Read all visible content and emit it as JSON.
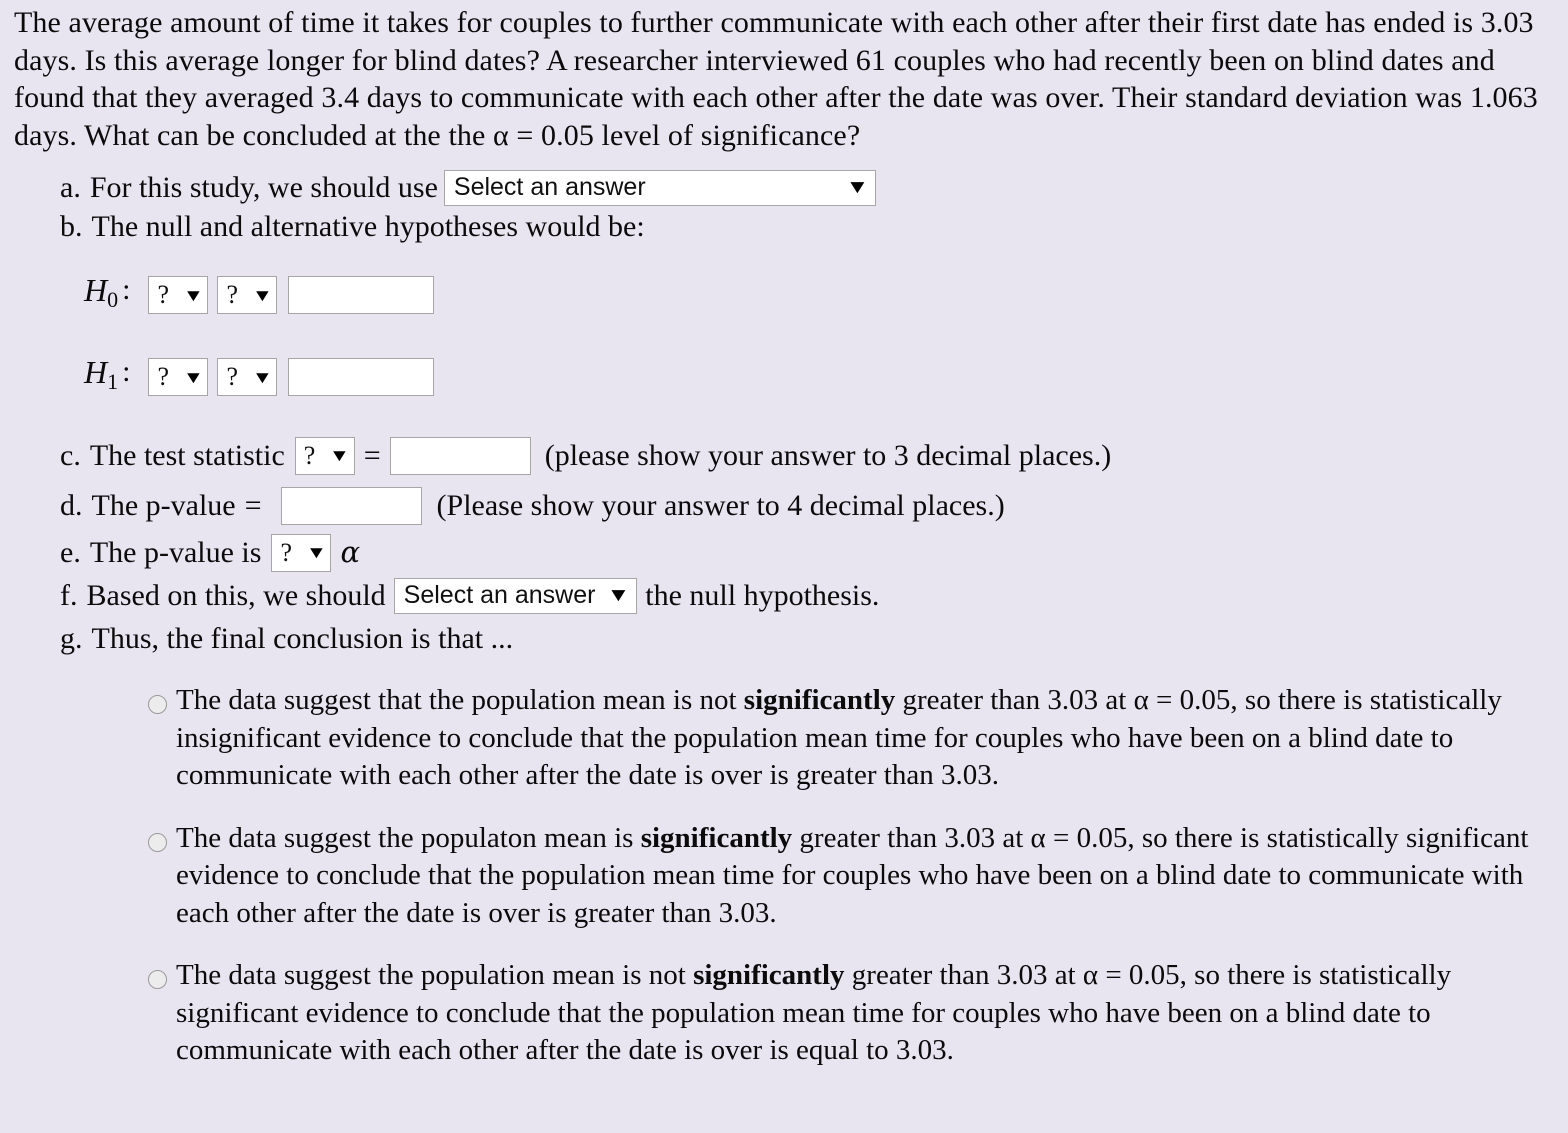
{
  "prompt": "The average amount of time it takes for couples to further communicate with each other after their first date has ended is 3.03 days.  Is this average longer for blind dates? A researcher interviewed 61 couples who had recently been on blind dates and found that they averaged 3.4 days to communicate with each other after the date was over.  Their standard deviation was 1.063 days. What can be concluded at the the α = 0.05 level of significance?",
  "questions": {
    "a": {
      "label": "a.",
      "text": "For this study, we should use",
      "select_value": "Select an answer",
      "caret": "▼"
    },
    "b": {
      "label": "b.",
      "text": "The null and alternative hypotheses would be:"
    },
    "h0": {
      "symbol": "H",
      "subscript": "0",
      "colon": ":",
      "dropdown1": "?",
      "dropdown2": "?",
      "value": "",
      "caret": "▼"
    },
    "h1": {
      "symbol": "H",
      "subscript": "1",
      "colon": ":",
      "dropdown1": "?",
      "dropdown2": "?",
      "value": "",
      "caret": "▼"
    },
    "c": {
      "label": "c.",
      "text": "The test statistic",
      "dropdown": "?",
      "caret": "▼",
      "equals": "=",
      "value": "",
      "hint": "(please show your answer to 3 decimal places.)"
    },
    "d": {
      "label": "d.",
      "text": "The p-value",
      "equals": "=",
      "value": "",
      "hint": "(Please show your answer to 4 decimal places.)"
    },
    "e": {
      "label": "e.",
      "text": "The p-value is",
      "dropdown": "?",
      "caret": "▼",
      "alpha": "α"
    },
    "f": {
      "label": "f.",
      "text": "Based on this, we should",
      "select_value": "Select an answer",
      "caret": "▼",
      "text_after": "the null hypothesis."
    },
    "g": {
      "label": "g.",
      "text": "Thus, the final conclusion is that ..."
    }
  },
  "choices": [
    {
      "id": "choice-1",
      "selected": false,
      "part1": "The data suggest that the population mean is not ",
      "bold": "significantly",
      "part2": " greater than 3.03 at α = 0.05, so there is statistically insignificant evidence to conclude that the population mean time for couples who have been on a blind date to communicate with each other after the date is over is greater than 3.03."
    },
    {
      "id": "choice-2",
      "selected": false,
      "part1": "The data suggest the populaton mean is ",
      "bold": "significantly",
      "part2": " greater than 3.03 at α = 0.05, so there is statistically significant evidence to conclude that the population mean time for couples who have been on a blind date to communicate with each other after the date is over is greater than 3.03."
    },
    {
      "id": "choice-3",
      "selected": false,
      "part1": "The data suggest the population mean is not ",
      "bold": "significantly",
      "part2": " greater than 3.03 at α = 0.05, so there is statistically significant evidence to conclude that the population mean time for couples who have been on a blind date to communicate with each other after the date is over is equal to 3.03."
    }
  ],
  "colors": {
    "background": "#e8e5f1",
    "field_background": "#ffffff",
    "field_border": "#a6a6a6",
    "radio_fill": "#ececec",
    "text": "#0b0b0b"
  }
}
